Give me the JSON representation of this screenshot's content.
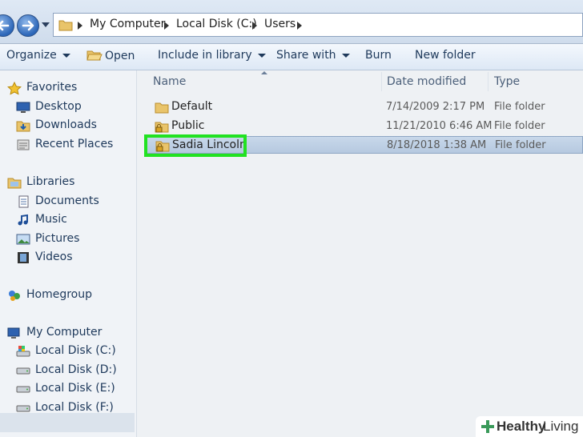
{
  "address_bar": {
    "crumbs": [
      "My Computer",
      "Local Disk (C:)",
      "Users"
    ]
  },
  "toolbar": {
    "organize": "Organize",
    "open": "Open",
    "include_in_library": "Include in library",
    "share_with": "Share with",
    "burn": "Burn",
    "new_folder": "New folder"
  },
  "sidebar": {
    "favorites": "Favorites",
    "desktop": "Desktop",
    "downloads": "Downloads",
    "recent_places": "Recent Places",
    "libraries": "Libraries",
    "documents": "Documents",
    "music": "Music",
    "pictures": "Pictures",
    "videos": "Videos",
    "homegroup": "Homegroup",
    "my_computer": "My Computer",
    "drive_c": "Local Disk (C:)",
    "drive_d": "Local Disk (D:)",
    "drive_e": "Local Disk (E:)",
    "drive_f": "Local Disk (F:)"
  },
  "columns": {
    "name": "Name",
    "date_modified": "Date modified",
    "type": "Type"
  },
  "files": [
    {
      "name": "Default",
      "date": "7/14/2009 2:17 PM",
      "type": "File folder",
      "icon": "folder-icon"
    },
    {
      "name": "Public",
      "date": "11/21/2010 6:46 AM",
      "type": "File folder",
      "icon": "locked-folder-icon"
    },
    {
      "name": "Sadia  Lincoln",
      "date": "8/18/2018 1:38 AM",
      "type": "File folder",
      "icon": "locked-folder-icon",
      "selected": true
    }
  ],
  "highlight_color": "#21e221",
  "watermark": {
    "part1": "Healthy",
    "part2": "Living"
  }
}
